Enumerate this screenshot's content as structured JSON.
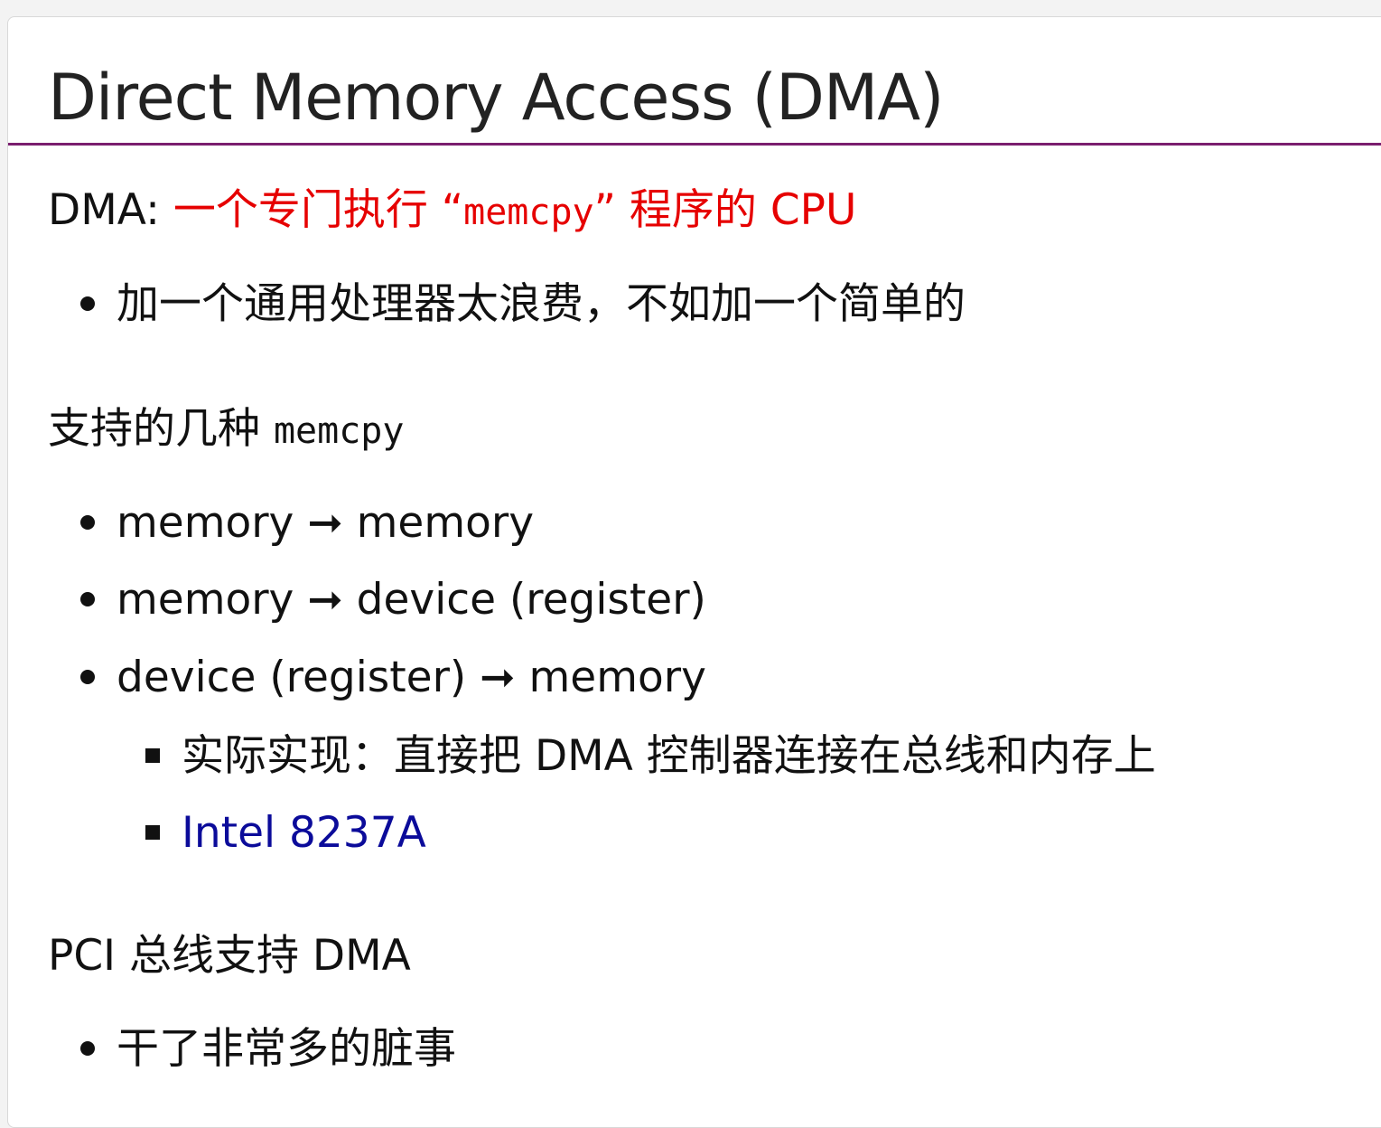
{
  "title": "Direct Memory Access (DMA)",
  "dma_line": {
    "prefix": "DMA: ",
    "highlight_before": "一个专门执行 “",
    "highlight_code": "memcpy",
    "highlight_after": "” 程序的 CPU"
  },
  "bullet_1": "加一个通用处理器太浪费，不如加一个简单的",
  "memcpy_heading": {
    "text": "支持的几种 ",
    "code": "memcpy"
  },
  "memcpy_items": [
    "memory ➞ memory",
    "memory ➞ device (register)",
    "device (register) ➞ memory"
  ],
  "sub_items": {
    "implementation": "实际实现：直接把 DMA 控制器连接在总线和内存上",
    "link": "Intel 8237A"
  },
  "pci_heading": "PCI 总线支持 DMA",
  "pci_item": "干了非常多的脏事",
  "colors": {
    "highlight": "#e60000",
    "link": "#0b0b9a",
    "rule": "#7a1e6e"
  }
}
